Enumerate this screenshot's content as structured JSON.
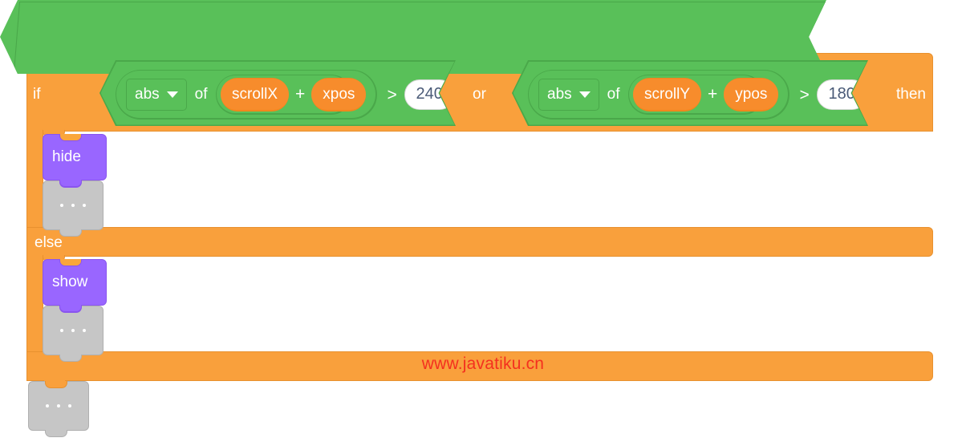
{
  "script": {
    "top_placeholder": {
      "icon": "ellipsis-dots",
      "label": "..."
    },
    "bottom_placeholder": {
      "icon": "ellipsis-dots",
      "label": "..."
    },
    "if_block": {
      "keyword_if": "if",
      "keyword_then": "then",
      "keyword_else": "else",
      "color": "#f9a03c"
    },
    "condition": {
      "operator": "or",
      "operator_label": "or",
      "color": "#59c059",
      "left": {
        "comparison": ">",
        "comparison_label": ">",
        "function": {
          "name": "abs",
          "dropdown_label": "abs",
          "of_label": "of",
          "argument": {
            "operator": "+",
            "operator_label": "+",
            "left_variable": "scrollX",
            "right_variable": "xpos",
            "variable_color": "#f78c2c"
          }
        },
        "threshold": "240"
      },
      "right": {
        "comparison": ">",
        "comparison_label": ">",
        "function": {
          "name": "abs",
          "dropdown_label": "abs",
          "of_label": "of",
          "argument": {
            "operator": "+",
            "operator_label": "+",
            "left_variable": "scrollY",
            "right_variable": "ypos",
            "variable_color": "#f78c2c"
          }
        },
        "threshold": "180"
      }
    },
    "then_branch": {
      "blocks": [
        {
          "label": "hide",
          "color": "#9966ff"
        },
        {
          "label": "...",
          "color": "#c6c6c6"
        }
      ]
    },
    "else_branch": {
      "blocks": [
        {
          "label": "show",
          "color": "#9966ff"
        },
        {
          "label": "...",
          "color": "#c6c6c6"
        }
      ]
    }
  },
  "watermark": {
    "text": "www.javatiku.cn",
    "color": "#f4301f"
  }
}
